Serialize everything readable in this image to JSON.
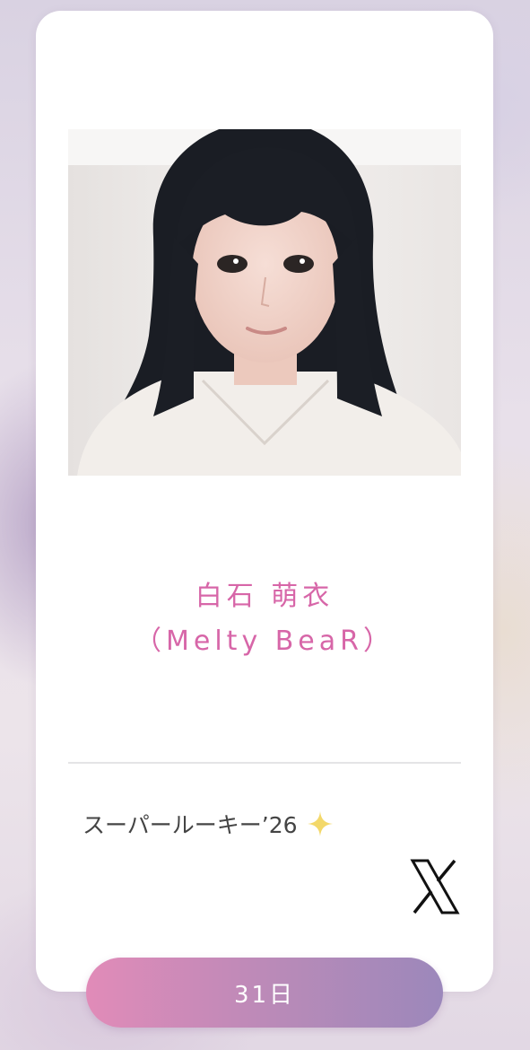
{
  "profile": {
    "name": "白石 萌衣",
    "group": "（Melty BeaR）",
    "tag": "スーパールーキー’26",
    "photo_icon": "portrait-photo",
    "sparkle_icon": "sparkle-icon",
    "social_icon": "x-logo-icon"
  },
  "footer": {
    "day_label": "31日"
  },
  "colors": {
    "name": "#d766a8",
    "tag_text": "#444444",
    "sparkle": "#f3d86a",
    "button_gradient_start": "#e18bb8",
    "button_gradient_end": "#9c88bb"
  }
}
